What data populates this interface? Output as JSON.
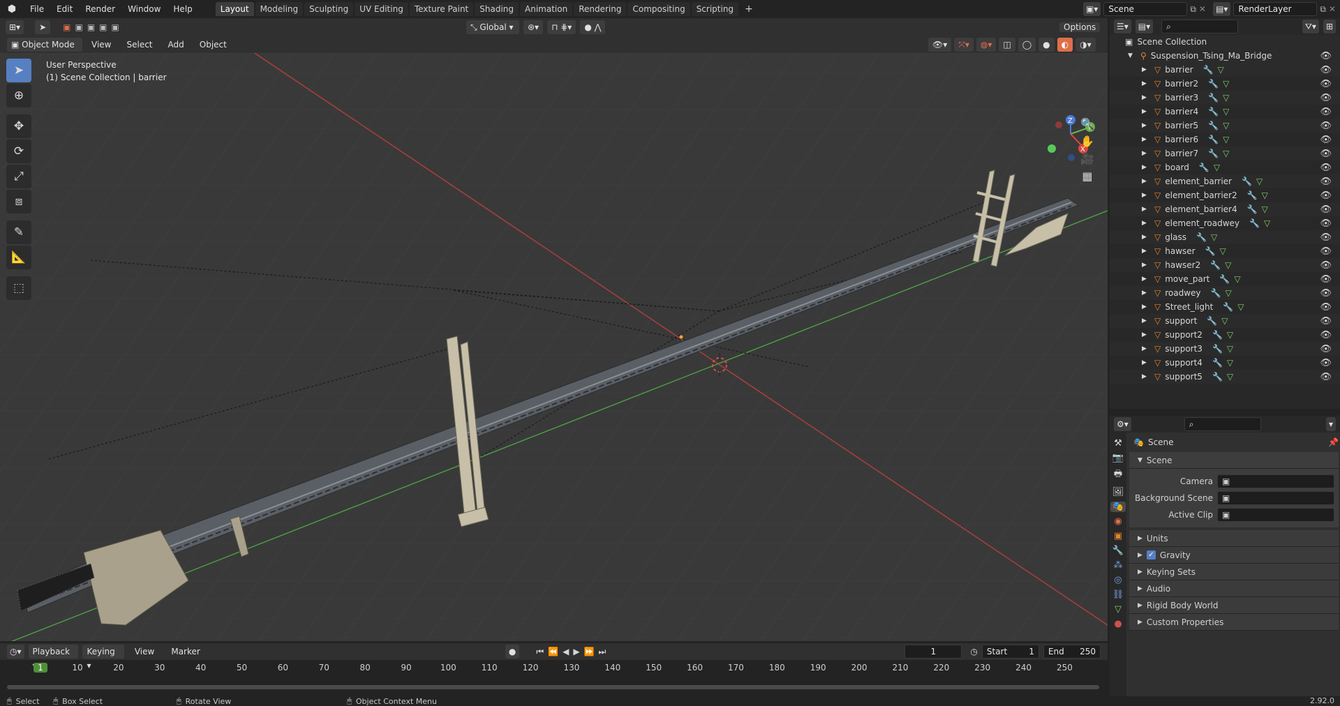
{
  "topbar": {
    "menus": [
      "File",
      "Edit",
      "Render",
      "Window",
      "Help"
    ],
    "tabs": [
      "Layout",
      "Modeling",
      "Sculpting",
      "UV Editing",
      "Texture Paint",
      "Shading",
      "Animation",
      "Rendering",
      "Compositing",
      "Scripting"
    ],
    "active_tab": "Layout",
    "add_tab": "+",
    "scene_name": "Scene",
    "view_layer": "RenderLayer"
  },
  "viewport_header": {
    "mode": "Object Mode",
    "menus": [
      "View",
      "Select",
      "Add",
      "Object"
    ],
    "orientation": "Global",
    "options": "Options"
  },
  "viewport": {
    "perspective_label": "User Perspective",
    "collection_label": "(1) Scene Collection | barrier",
    "gizmo_axes": [
      "Z",
      "Y",
      "X"
    ]
  },
  "outliner": {
    "root": "Scene Collection",
    "collection": "Suspension_Tsing_Ma_Bridge",
    "objects": [
      "barrier",
      "barrier2",
      "barrier3",
      "barrier4",
      "barrier5",
      "barrier6",
      "barrier7",
      "board",
      "element_barrier",
      "element_barrier2",
      "element_barrier4",
      "element_roadwey",
      "glass",
      "hawser",
      "hawser2",
      "move_part",
      "roadwey",
      "Street_light",
      "support",
      "support2",
      "support3",
      "support4",
      "support5"
    ]
  },
  "properties": {
    "header": "Scene",
    "section": "Scene",
    "fields": [
      {
        "label": "Camera",
        "value": ""
      },
      {
        "label": "Background Scene",
        "value": ""
      },
      {
        "label": "Active Clip",
        "value": ""
      }
    ],
    "subpanels": [
      "Units",
      "Gravity",
      "Keying Sets",
      "Audio",
      "Rigid Body World",
      "Custom Properties"
    ],
    "gravity_checked": true
  },
  "timeline": {
    "menus": [
      "Playback",
      "Keying",
      "View",
      "Marker"
    ],
    "current_frame": "1",
    "start_label": "Start",
    "start": "1",
    "end_label": "End",
    "end": "250",
    "ticks": [
      "1",
      "10",
      "20",
      "30",
      "40",
      "50",
      "60",
      "70",
      "80",
      "90",
      "100",
      "110",
      "120",
      "130",
      "140",
      "150",
      "160",
      "170",
      "180",
      "190",
      "200",
      "210",
      "220",
      "230",
      "240",
      "250"
    ]
  },
  "statusbar": {
    "select": "Select",
    "box_select": "Box Select",
    "rotate_view": "Rotate View",
    "context_menu": "Object Context Menu",
    "version": "2.92.0"
  }
}
